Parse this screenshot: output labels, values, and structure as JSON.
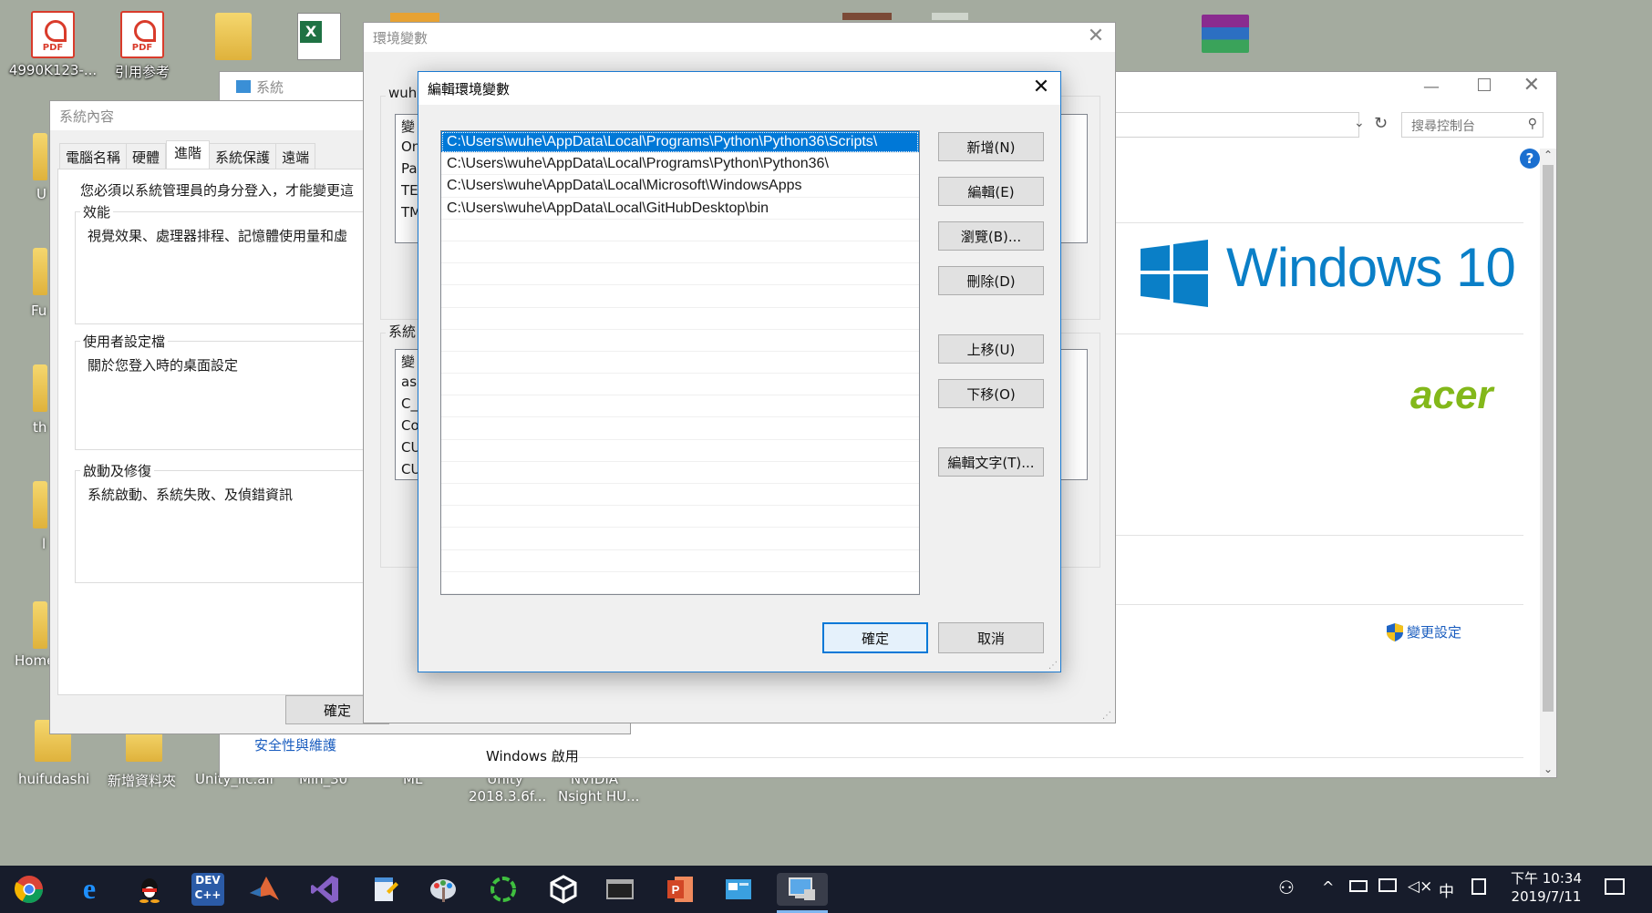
{
  "desktop": {
    "icons": [
      {
        "label": "4990K123-..."
      },
      {
        "label": "引用参考"
      },
      {
        "label": "U"
      },
      {
        "label": "Fu"
      },
      {
        "label": "th"
      },
      {
        "label": "l"
      },
      {
        "label": "Home"
      },
      {
        "label": "huifudashi"
      },
      {
        "label": "新增資料夾"
      },
      {
        "label": "Unity_lic.ali"
      },
      {
        "label": "Min_30"
      },
      {
        "label": "ML"
      },
      {
        "label": "Unity\n2018.3.6f..."
      },
      {
        "label": "NVIDIA\nNsight HU..."
      }
    ]
  },
  "control_panel": {
    "title": "系統",
    "search_placeholder": "搜尋控制台",
    "brand_text": "Windows 10",
    "oem_logo": "acer",
    "change_settings": "變更設定",
    "security_link": "安全性與維護",
    "activation_label": "Windows 啟用"
  },
  "system_properties": {
    "title": "系統內容",
    "tabs": [
      "電腦名稱",
      "硬體",
      "進階",
      "系統保護",
      "遠端"
    ],
    "admin_note": "您必須以系統管理員的身分登入，才能變更這",
    "groups": [
      {
        "label": "效能",
        "text": "視覺效果、處理器排程、記憶體使用量和虛"
      },
      {
        "label": "使用者設定檔",
        "text": "關於您登入時的桌面設定"
      },
      {
        "label": "啟動及修復",
        "text": "系統啟動、系統失敗、及偵錯資訊"
      }
    ],
    "ok_label": "確定"
  },
  "env_vars": {
    "title": "環境變數",
    "user_section_label": "wuhe",
    "user_vars": [
      "變",
      "On",
      "Pa",
      "TE",
      "TM"
    ],
    "system_section_label": "系統",
    "system_vars": [
      "變",
      "ask",
      "C_",
      "Co",
      "CU",
      "CU"
    ]
  },
  "edit_env": {
    "title": "編輯環境變數",
    "paths": [
      "C:\\Users\\wuhe\\AppData\\Local\\Programs\\Python\\Python36\\Scripts\\",
      "C:\\Users\\wuhe\\AppData\\Local\\Programs\\Python\\Python36\\",
      "C:\\Users\\wuhe\\AppData\\Local\\Microsoft\\WindowsApps",
      "C:\\Users\\wuhe\\AppData\\Local\\GitHubDesktop\\bin"
    ],
    "buttons": {
      "new": "新增(N)",
      "edit": "編輯(E)",
      "browse": "瀏覽(B)...",
      "delete": "刪除(D)",
      "move_up": "上移(U)",
      "move_down": "下移(O)",
      "edit_text": "編輯文字(T)...",
      "ok": "確定",
      "cancel": "取消"
    }
  },
  "taskbar": {
    "ime": "中",
    "time": "下午 10:34",
    "date": "2019/7/11"
  },
  "colors": {
    "accent": "#0078d7",
    "windows_blue": "#0a7fc7",
    "acer_green": "#83b81a",
    "desktop": "#a4ab9f",
    "taskbar": "#171c2b"
  }
}
